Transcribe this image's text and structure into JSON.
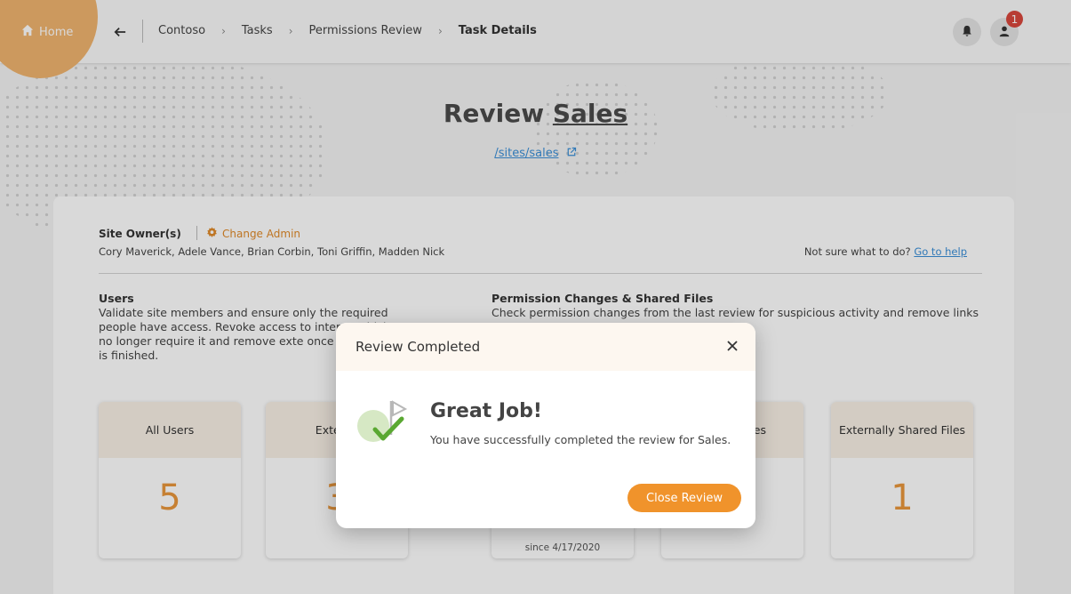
{
  "header": {
    "home_label": "Home",
    "breadcrumb": [
      "Contoso",
      "Tasks",
      "Permissions Review",
      "Task Details"
    ],
    "notification_count": "1"
  },
  "page": {
    "title_prefix": "Review",
    "title_site": "Sales",
    "site_url": "/sites/sales"
  },
  "owners": {
    "label": "Site Owner(s)",
    "change_admin_label": "Change Admin",
    "names": "Cory Maverick, Adele Vance, Brian Corbin, Toni Griffin, Madden Nick",
    "help_prefix": "Not sure what to do?",
    "help_link": "Go to help"
  },
  "sections": {
    "users": {
      "title": "Users",
      "desc": "Validate site members and ensure only the required people have access. Revoke access to interna which no longer require it and remove exte once their work is finished."
    },
    "permissions": {
      "title": "Permission Changes & Shared Files",
      "desc": "Check permission changes from the last review for suspicious activity and remove links"
    }
  },
  "tiles": [
    {
      "label": "All Users",
      "value": "5",
      "foot": ""
    },
    {
      "label": "Externa",
      "value": "3",
      "foot": ""
    },
    {
      "label": "",
      "value": "",
      "foot": "since 4/17/2020"
    },
    {
      "label": "es",
      "value": "",
      "foot": ""
    },
    {
      "label": "Externally Shared Files",
      "value": "1",
      "foot": ""
    }
  ],
  "modal": {
    "title": "Review Completed",
    "heading": "Great Job!",
    "message": "You have successfully completed the review for Sales.",
    "button_label": "Close Review"
  },
  "colors": {
    "accent": "#f0932b",
    "home_blob": "#f0b46f",
    "link": "#3a8fd8",
    "badge": "#d9473c"
  }
}
